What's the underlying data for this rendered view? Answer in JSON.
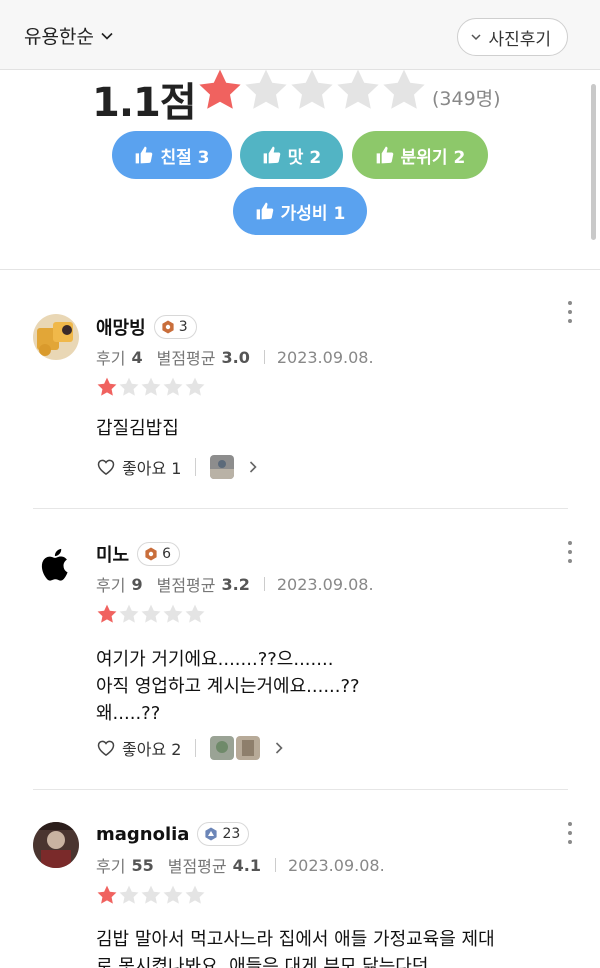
{
  "header": {
    "sort_label": "유용한순",
    "photo_review_label": "사진후기"
  },
  "summary": {
    "score": "1.1점",
    "rating": 1,
    "max_rating": 5,
    "count": "(349명)",
    "tags": [
      {
        "label": "친절 3",
        "color": "#5aa2ef"
      },
      {
        "label": "맛 2",
        "color": "#52b4c4"
      },
      {
        "label": "분위기 2",
        "color": "#8dc86a"
      },
      {
        "label": "가성비 1",
        "color": "#5aa2ef"
      }
    ]
  },
  "colors": {
    "star_active": "#f0625f",
    "star_inactive": "#e4e4e4"
  },
  "reviews": [
    {
      "name": "애망빙",
      "badge_level": "3",
      "badge_icon": "orange-hexagon-icon",
      "reviews_label": "후기",
      "reviews_count": "4",
      "avg_label": "별점평균",
      "avg_value": "3.0",
      "date": "2023.09.08.",
      "rating": 1,
      "text": "갑질김밥집",
      "like_label": "좋아요 1"
    },
    {
      "name": "미노",
      "badge_level": "6",
      "badge_icon": "orange-hexagon-icon",
      "reviews_label": "후기",
      "reviews_count": "9",
      "avg_label": "별점평균",
      "avg_value": "3.2",
      "date": "2023.09.08.",
      "rating": 1,
      "text": "여기가 거기에요.......??으.......\n아직 영업하고 계시는거에요......??\n왜.....??",
      "like_label": "좋아요 2"
    },
    {
      "name": "magnolia",
      "badge_level": "23",
      "badge_icon": "blue-triangle-icon",
      "reviews_label": "후기",
      "reviews_count": "55",
      "avg_label": "별점평균",
      "avg_value": "4.1",
      "date": "2023.09.08.",
      "rating": 1,
      "text": "김밥 말아서 먹고사느라 집에서 애들 가정교육을 제대\n로 못시켰나봐요. 애들은 대게 부모 닮는다던",
      "like_label": ""
    }
  ]
}
